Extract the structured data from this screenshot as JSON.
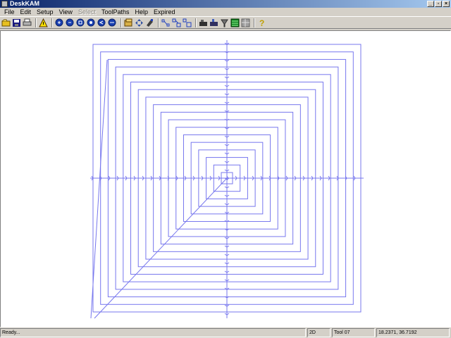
{
  "window": {
    "title": "DeskKAM",
    "controls": {
      "minimize": "_",
      "maximize": "▫",
      "close": "×"
    }
  },
  "menu": [
    {
      "label": "File",
      "enabled": true
    },
    {
      "label": "Edit",
      "enabled": true
    },
    {
      "label": "Setup",
      "enabled": true
    },
    {
      "label": "View",
      "enabled": true
    },
    {
      "label": "Select",
      "enabled": false
    },
    {
      "label": "ToolPaths",
      "enabled": true
    },
    {
      "label": "Help",
      "enabled": true
    },
    {
      "label": "Expired",
      "enabled": true
    }
  ],
  "toolbar": {
    "groups": [
      [
        "open-icon",
        "save-icon",
        "print-icon"
      ],
      [
        "warning-icon"
      ],
      [
        "zoom-in-icon",
        "zoom-out-icon",
        "zoom-window-icon",
        "zoom-fit-icon",
        "zoom-prev-icon",
        "zoom-all-icon"
      ],
      [
        "select-icon",
        "move-icon",
        "rotate-icon"
      ],
      [
        "nodes-icon",
        "link-icon",
        "unlink-icon"
      ],
      [
        "machine-icon",
        "cut-icon",
        "tool-icon",
        "layers-icon",
        "grid-icon"
      ],
      [
        "help-icon"
      ]
    ]
  },
  "canvas": {
    "path_color": "#7777ee",
    "loops": 18
  },
  "status": {
    "message": "Ready...",
    "mode": "2D",
    "tool": "Tool 07",
    "coordinates": "18.2371, 36.7192"
  }
}
